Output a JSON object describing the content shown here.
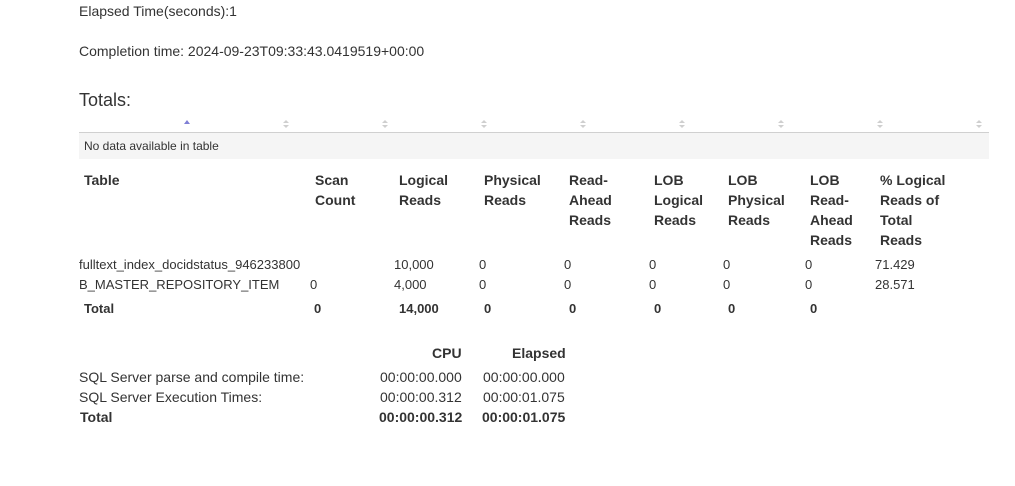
{
  "elapsed": "Elapsed Time(seconds):1",
  "completion": "Completion time: 2024-09-23T09:33:43.0419519+00:00",
  "totals_heading": "Totals:",
  "empty_message": "No data available in table",
  "io_table": {
    "headers": [
      "Table",
      "Scan Count",
      "Logical Reads",
      "Physical Reads",
      "Read-Ahead Reads",
      "LOB Logical Reads",
      "LOB Physical Reads",
      "LOB Read-Ahead Reads",
      "% Logical Reads of Total Reads"
    ],
    "rows": [
      [
        "fulltext_index_docidstatus_946233800",
        "",
        "10,000",
        "0",
        "0",
        "0",
        "0",
        "0",
        "71.429"
      ],
      [
        "B_MASTER_REPOSITORY_ITEM",
        "0",
        "4,000",
        "0",
        "0",
        "0",
        "0",
        "0",
        "28.571"
      ]
    ],
    "total": [
      "Total",
      "0",
      "14,000",
      "0",
      "0",
      "0",
      "0",
      "0"
    ]
  },
  "time_table": {
    "headers": [
      "CPU",
      "Elapsed"
    ],
    "rows": [
      [
        "SQL Server parse and compile time:",
        "00:00:00.000",
        "00:00:00.000"
      ],
      [
        "SQL Server Execution Times:",
        "00:00:00.312",
        "00:00:01.075"
      ]
    ],
    "total": [
      "Total",
      "00:00:00.312",
      "00:00:01.075"
    ]
  }
}
